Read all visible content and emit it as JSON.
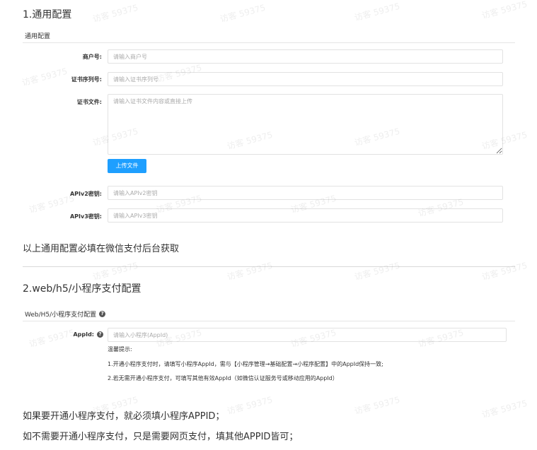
{
  "section1": {
    "title": "1.通用配置",
    "subheading": "通用配置",
    "fields": {
      "merchant_id": {
        "label": "商户号:",
        "placeholder": "请输入商户号"
      },
      "cert_serial": {
        "label": "证书序列号:",
        "placeholder": "请输入证书序列号"
      },
      "cert_file": {
        "label": "证书文件:",
        "placeholder": "请输入证书文件内容或直接上传"
      },
      "apiv2_key": {
        "label": "APIv2密钥:",
        "placeholder": "请输入APIv2密钥"
      },
      "apiv3_key": {
        "label": "APIv3密钥:",
        "placeholder": "请输入APIv3密钥"
      }
    },
    "upload_button": "上传文件",
    "note": "以上通用配置必填在微信支付后台获取"
  },
  "section2": {
    "title": "2.web/h5/小程序支付配置",
    "subheading": "Web/H5/小程序支付配置",
    "appid": {
      "label": "AppId:",
      "placeholder": "请输入小程序(AppId)"
    },
    "tips_title": "温馨提示:",
    "tip1": "1.开通小程序支付时，请填写小程序AppId，需与【小程序管理→基础配置→小程序配置】中的AppId保持一致;",
    "tip2": "2.若无需开通小程序支付，可填写其他有效AppId（如微信认证服务号或移动应用的AppId）",
    "note1": "如果要开通小程序支付，就必须填小程序APPID；",
    "note2": "如不需要开通小程序支付，只是需要网页支付，填其他APPID皆可；"
  },
  "watermark": "访客 59375",
  "icons": {
    "help": "question-circle-icon"
  },
  "colors": {
    "primary_button": "#1e9fff"
  }
}
